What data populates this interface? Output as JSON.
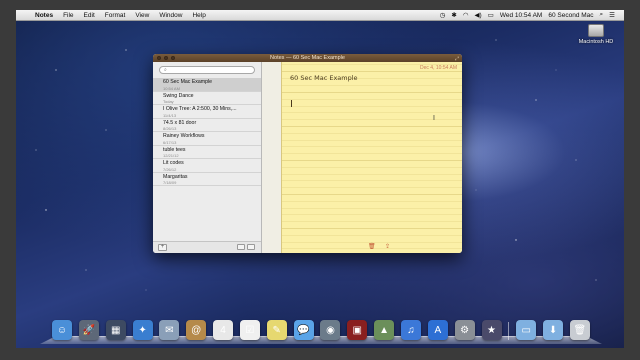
{
  "menubar": {
    "app_name": "Notes",
    "menus": [
      "File",
      "Edit",
      "Format",
      "View",
      "Window",
      "Help"
    ],
    "clock": "Wed 10:54 AM",
    "user": "60 Second Mac"
  },
  "desktop": {
    "hd_label": "Macintosh HD"
  },
  "window": {
    "title": "Notes — 60 Sec Mac Example"
  },
  "sidebar": {
    "notes": [
      {
        "title": "60 Sec Mac Example",
        "date": "10:54 AM"
      },
      {
        "title": "Swing Dance",
        "date": "Today"
      },
      {
        "title": "I Olive Tree: A 2:500, 30 Mins,...",
        "date": "11/4/13"
      },
      {
        "title": "74.5 x 81 door",
        "date": "8/26/13"
      },
      {
        "title": "Rainey Workflows",
        "date": "6/17/13"
      },
      {
        "title": "tuble tees",
        "date": "12/21/12"
      },
      {
        "title": "Lit codes",
        "date": "7/26/12"
      },
      {
        "title": "Margaritas",
        "date": "7/18/09"
      }
    ],
    "add_label": "+"
  },
  "note": {
    "date": "Dec 4, 10:54 AM",
    "body": "60 Sec Mac Example"
  },
  "dock": {
    "icons": [
      {
        "name": "finder-icon",
        "color": "#4a8fd8",
        "glyph": "☺"
      },
      {
        "name": "launchpad-icon",
        "color": "#5d6878",
        "glyph": "🚀"
      },
      {
        "name": "mission-control-icon",
        "color": "#3d4a62",
        "glyph": "▦"
      },
      {
        "name": "safari-icon",
        "color": "#3a7ed0",
        "glyph": "✦"
      },
      {
        "name": "mail-icon",
        "color": "#8a9fb8",
        "glyph": "✉"
      },
      {
        "name": "contacts-icon",
        "color": "#b58a4a",
        "glyph": "@"
      },
      {
        "name": "calendar-icon",
        "color": "#e8e8e8",
        "glyph": "4"
      },
      {
        "name": "reminders-icon",
        "color": "#f0f0f0",
        "glyph": "☑"
      },
      {
        "name": "notes-icon",
        "color": "#e6d870",
        "glyph": "✎"
      },
      {
        "name": "messages-icon",
        "color": "#5aa4e8",
        "glyph": "💬"
      },
      {
        "name": "facetime-icon",
        "color": "#6b7b8a",
        "glyph": "◉"
      },
      {
        "name": "photo-booth-icon",
        "color": "#8a1f1f",
        "glyph": "▣"
      },
      {
        "name": "iphoto-icon",
        "color": "#6b8f5a",
        "glyph": "▲"
      },
      {
        "name": "itunes-icon",
        "color": "#3b78d8",
        "glyph": "♫"
      },
      {
        "name": "app-store-icon",
        "color": "#2d6fd4",
        "glyph": "A"
      },
      {
        "name": "system-preferences-icon",
        "color": "#8a8f96",
        "glyph": "⚙"
      },
      {
        "name": "imovie-icon",
        "color": "#4a4a6a",
        "glyph": "★"
      },
      {
        "name": "applications-folder-icon",
        "color": "#7fb0e0",
        "glyph": "▭"
      },
      {
        "name": "downloads-folder-icon",
        "color": "#7fb0e0",
        "glyph": "⬇"
      },
      {
        "name": "trash-icon",
        "color": "#c8ccd2",
        "glyph": "🗑"
      }
    ]
  }
}
